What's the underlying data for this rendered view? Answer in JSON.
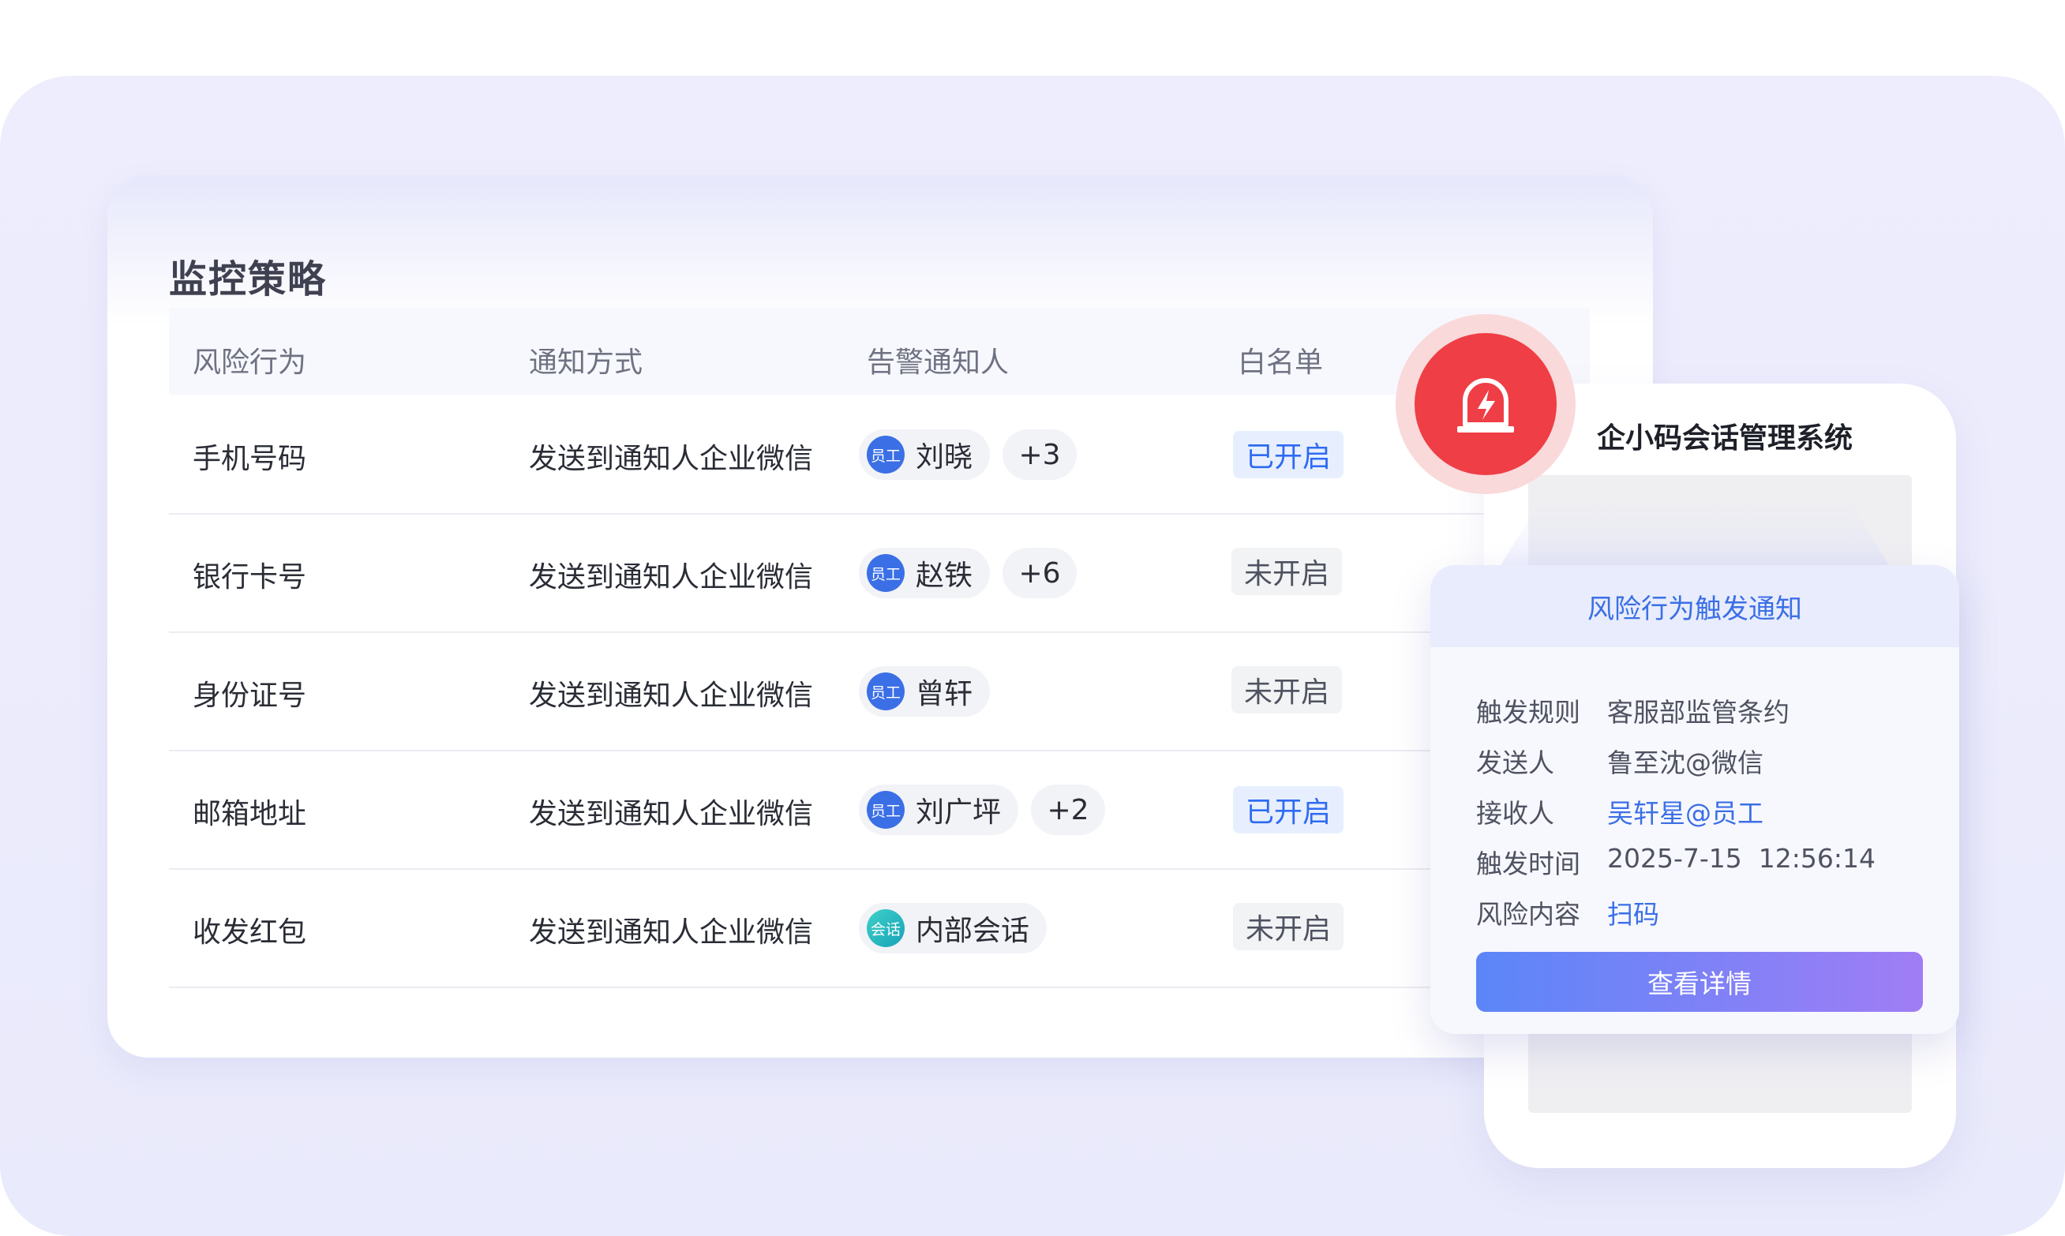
{
  "page": {
    "title": "监控策略"
  },
  "table": {
    "columns": [
      "风险行为",
      "通知方式",
      "告警通知人",
      "白名单"
    ],
    "rows": [
      {
        "behavior": "手机号码",
        "method": "发送到通知人企业微信",
        "avatar": "员工",
        "person": "刘晓",
        "extra": "+3",
        "status": "已开启",
        "enabled": true
      },
      {
        "behavior": "银行卡号",
        "method": "发送到通知人企业微信",
        "avatar": "员工",
        "person": "赵铁",
        "extra": "+6",
        "status": "未开启",
        "enabled": false
      },
      {
        "behavior": "身份证号",
        "method": "发送到通知人企业微信",
        "avatar": "员工",
        "person": "曾轩",
        "extra": "",
        "status": "未开启",
        "enabled": false
      },
      {
        "behavior": "邮箱地址",
        "method": "发送到通知人企业微信",
        "avatar": "员工",
        "person": "刘广坪",
        "extra": "+2",
        "status": "已开启",
        "enabled": true
      },
      {
        "behavior": "收发红包",
        "method": "发送到通知人企业微信",
        "avatar": "会话",
        "person": "内部会话",
        "extra": "",
        "status": "未开启",
        "enabled": false
      }
    ]
  },
  "phone": {
    "app_title": "企小码会话管理系统"
  },
  "notification": {
    "title": "风险行为触发通知",
    "fields": [
      {
        "key": "触发规则",
        "value": "客服部监管条约",
        "link": false
      },
      {
        "key": "发送人",
        "value": "鲁至沈@微信",
        "link": false
      },
      {
        "key": "接收人",
        "value": "吴轩星@员工",
        "link": true
      },
      {
        "key": "触发时间",
        "value": "2025-7-15  12:56:14",
        "link": false
      },
      {
        "key": "风险内容",
        "value": "扫码",
        "link": true
      }
    ],
    "button": "查看详情"
  },
  "icons": {
    "alarm": "alarm-siren-icon"
  },
  "colors": {
    "accent": "#3b6fe6",
    "alarm": "#ef3e46",
    "enabled_bg": "#e7efff"
  }
}
